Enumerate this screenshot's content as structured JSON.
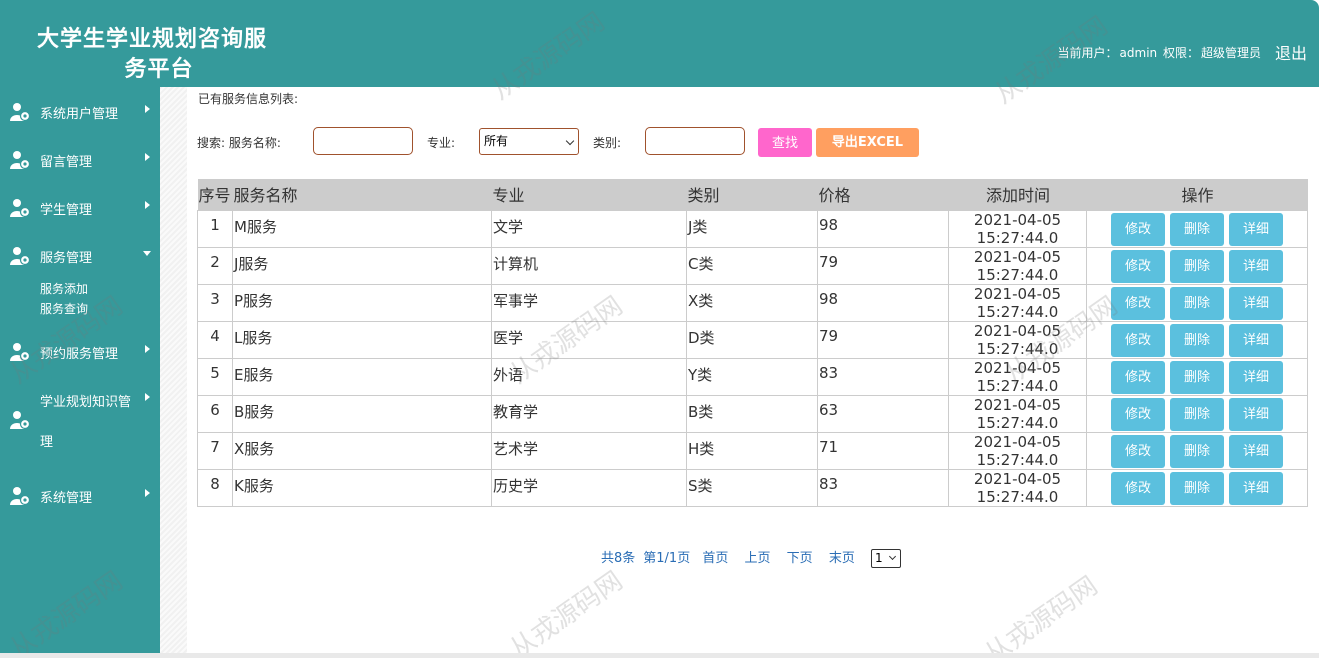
{
  "header": {
    "title_line1": "大学生学业规划咨询服",
    "title_line2": "务平台",
    "current_user_label": "当前用户：",
    "current_user": "admin",
    "role_label": "权限：",
    "role": "超级管理员",
    "logout": "退出"
  },
  "sidebar": {
    "items": [
      {
        "label": "系统用户管理"
      },
      {
        "label": "留言管理"
      },
      {
        "label": "学生管理"
      },
      {
        "label": "服务管理",
        "sub": [
          "服务添加",
          "服务查询"
        ]
      },
      {
        "label": "预约服务管理"
      },
      {
        "label": "学业规划知识管",
        "label2": "理"
      },
      {
        "label": "系统管理"
      }
    ]
  },
  "main": {
    "list_title": "已有服务信息列表:",
    "search_label": "搜索: 服务名称:",
    "major_label": "专业:",
    "major_selected": "所有",
    "category_label": "类别:",
    "find_button": "查找",
    "export_button": "导出EXCEL"
  },
  "table": {
    "headers": [
      "序号",
      "服务名称",
      "专业",
      "类别",
      "价格",
      "添加时间",
      "操作"
    ],
    "rows": [
      {
        "no": "1",
        "name": "M服务",
        "major": "文学",
        "cat": "J类",
        "price": "98",
        "date": "2021-04-05",
        "time": "15:27:44.0"
      },
      {
        "no": "2",
        "name": "J服务",
        "major": "计算机",
        "cat": "C类",
        "price": "79",
        "date": "2021-04-05",
        "time": "15:27:44.0"
      },
      {
        "no": "3",
        "name": "P服务",
        "major": "军事学",
        "cat": "X类",
        "price": "98",
        "date": "2021-04-05",
        "time": "15:27:44.0"
      },
      {
        "no": "4",
        "name": "L服务",
        "major": "医学",
        "cat": "D类",
        "price": "79",
        "date": "2021-04-05",
        "time": "15:27:44.0"
      },
      {
        "no": "5",
        "name": "E服务",
        "major": "外语",
        "cat": "Y类",
        "price": "83",
        "date": "2021-04-05",
        "time": "15:27:44.0"
      },
      {
        "no": "6",
        "name": "B服务",
        "major": "教育学",
        "cat": "B类",
        "price": "63",
        "date": "2021-04-05",
        "time": "15:27:44.0"
      },
      {
        "no": "7",
        "name": "X服务",
        "major": "艺术学",
        "cat": "H类",
        "price": "71",
        "date": "2021-04-05",
        "time": "15:27:44.0"
      },
      {
        "no": "8",
        "name": "K服务",
        "major": "历史学",
        "cat": "S类",
        "price": "83",
        "date": "2021-04-05",
        "time": "15:27:44.0"
      }
    ],
    "actions": {
      "edit": "修改",
      "delete": "删除",
      "detail": "详细"
    }
  },
  "pager": {
    "total": "共8条",
    "page": "第1/1页",
    "first": "首页",
    "prev": "上页",
    "next": "下页",
    "last": "末页",
    "current": "1"
  },
  "watermark": "从戎源码网",
  "colors": {
    "header_bg": "#359a9b",
    "find_button": "#ff66cc",
    "export_button": "#ff9f60",
    "action_button": "#5bc0de",
    "table_header": "#cccccc"
  }
}
